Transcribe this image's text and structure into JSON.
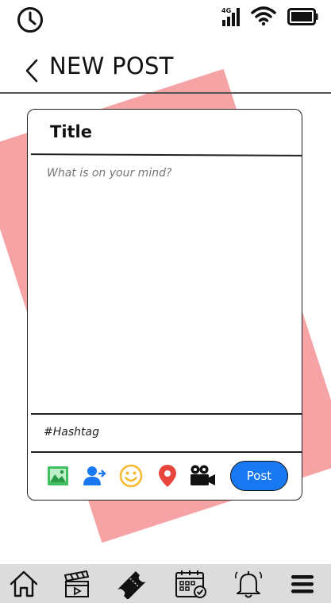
{
  "status_bar": {
    "network_label": "4G",
    "icons": [
      "clock-icon",
      "cellular-signal-icon",
      "wifi-icon",
      "battery-icon"
    ]
  },
  "header": {
    "back_icon": "chevron-left-icon",
    "title": "NEW POST"
  },
  "post_card": {
    "title_placeholder": "Title",
    "body_placeholder": "What is on your mind?",
    "hashtag_placeholder": "#Hashtag",
    "toolbar_icons": [
      "photo-icon",
      "tag-person-icon",
      "emoji-icon",
      "location-pin-icon",
      "video-camera-icon"
    ],
    "post_label": "Post"
  },
  "bottom_nav": {
    "items": [
      "home-icon",
      "clapperboard-icon",
      "ticket-icon",
      "calendar-icon",
      "bell-icon",
      "menu-icon"
    ]
  },
  "colors": {
    "accent_shape": "#f6a3a5",
    "post_button": "#1778f2",
    "nav_bar": "#dcdcdc"
  }
}
